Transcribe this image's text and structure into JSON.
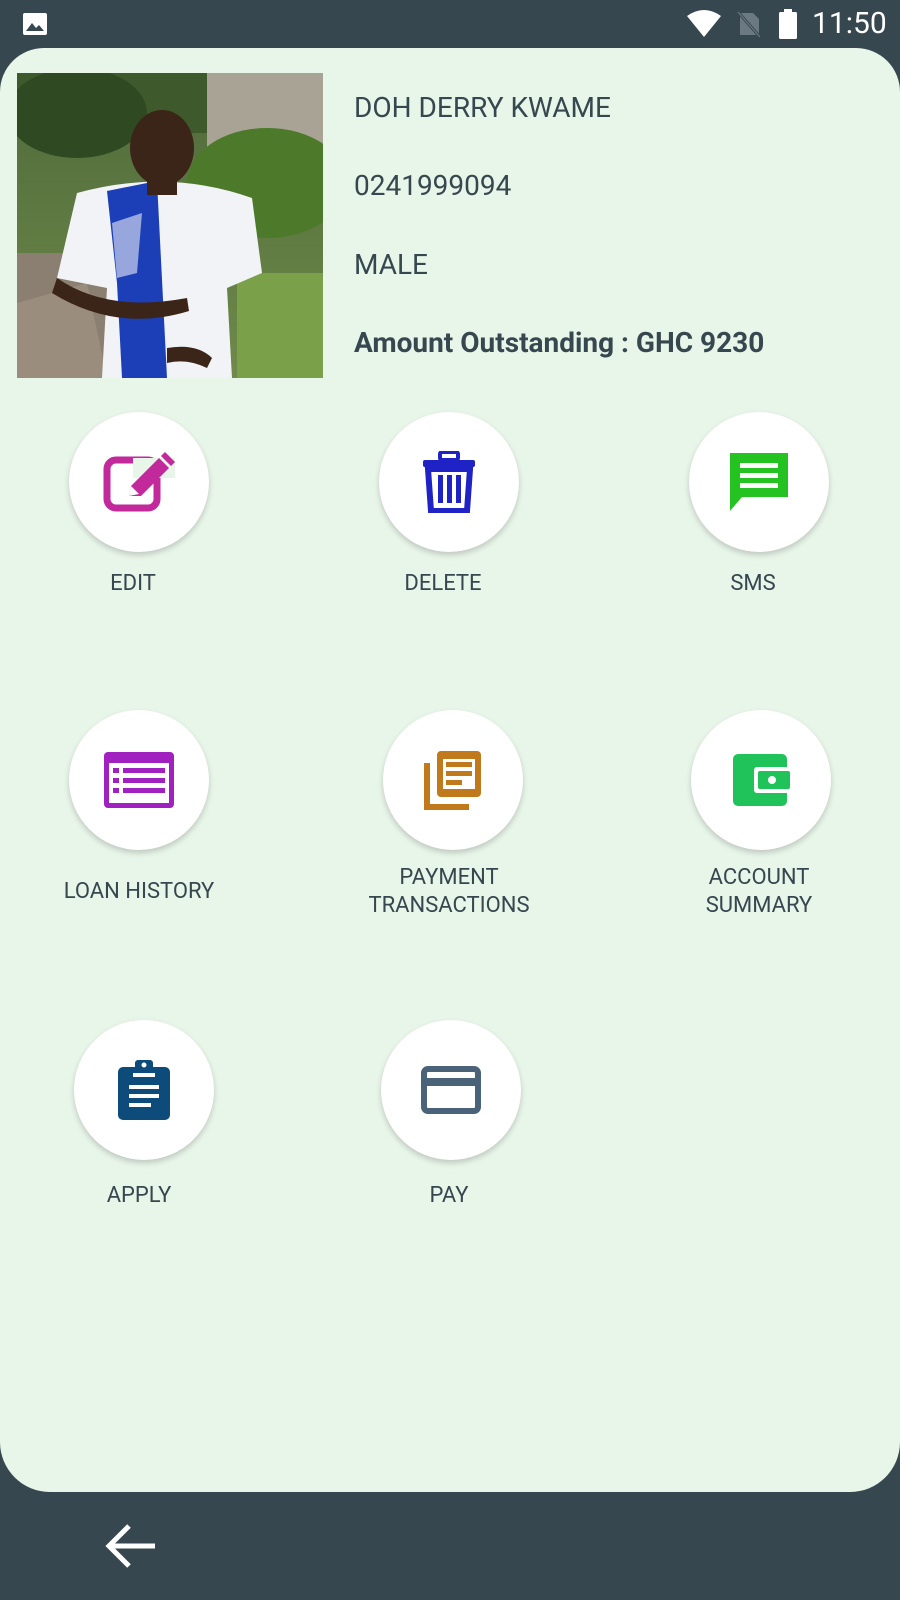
{
  "status_bar": {
    "time": "11:50"
  },
  "profile": {
    "name": "DOH DERRY KWAME",
    "phone": "0241999094",
    "gender": "MALE",
    "amount_outstanding": "Amount Outstanding : GHC 9230"
  },
  "actions": {
    "edit": {
      "label": "EDIT",
      "icon": "edit-icon",
      "color": "#c2299b"
    },
    "delete": {
      "label": "DELETE",
      "icon": "trash-icon",
      "color": "#1f22c5"
    },
    "sms": {
      "label": "SMS",
      "icon": "message-icon",
      "color": "#25c322"
    },
    "loan_history": {
      "label": "LOAN HISTORY",
      "icon": "list-icon",
      "color": "#a020c0"
    },
    "payment_transactions": {
      "label_line1": "PAYMENT",
      "label_line2": "TRANSACTIONS",
      "icon": "documents-icon",
      "color": "#c07a1c"
    },
    "account_summary": {
      "label_line1": "ACCOUNT",
      "label_line2": "SUMMARY",
      "icon": "wallet-icon",
      "color": "#20c35a"
    },
    "apply": {
      "label": "APPLY",
      "icon": "clipboard-icon",
      "color": "#0d4b7a"
    },
    "pay": {
      "label": "PAY",
      "icon": "credit-card-icon",
      "color": "#4a6378"
    }
  },
  "colors": {
    "dark_bar": "#37474f",
    "card_background": "#e8f5e9",
    "text": "#37474f"
  }
}
